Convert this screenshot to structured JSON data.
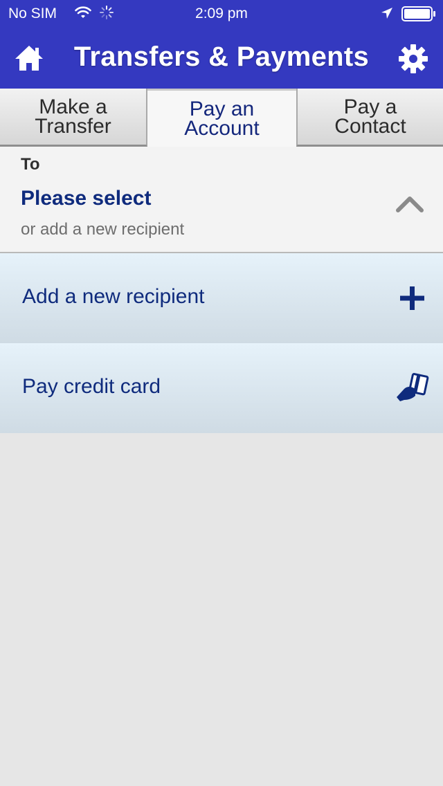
{
  "status": {
    "carrier": "No SIM",
    "time": "2:09 pm"
  },
  "navbar": {
    "title": "Transfers & Payments",
    "home_icon": "home-icon",
    "settings_icon": "gear-icon"
  },
  "tabs": [
    {
      "label": "Make a\nTransfer",
      "selected": false
    },
    {
      "label": "Pay an\nAccount",
      "selected": true
    },
    {
      "label": "Pay a\nContact",
      "selected": false
    }
  ],
  "recipient": {
    "label": "To",
    "value": "Please select",
    "hint": "or add a new recipient",
    "toggle_icon": "chevron-up-icon"
  },
  "options": [
    {
      "label": "Add a new recipient",
      "icon": "plus-icon"
    },
    {
      "label": "Pay credit card",
      "icon": "credit-card-hand-icon"
    }
  ],
  "colors": {
    "brand": "#3439c0",
    "accent_text": "#0f2b7d"
  }
}
